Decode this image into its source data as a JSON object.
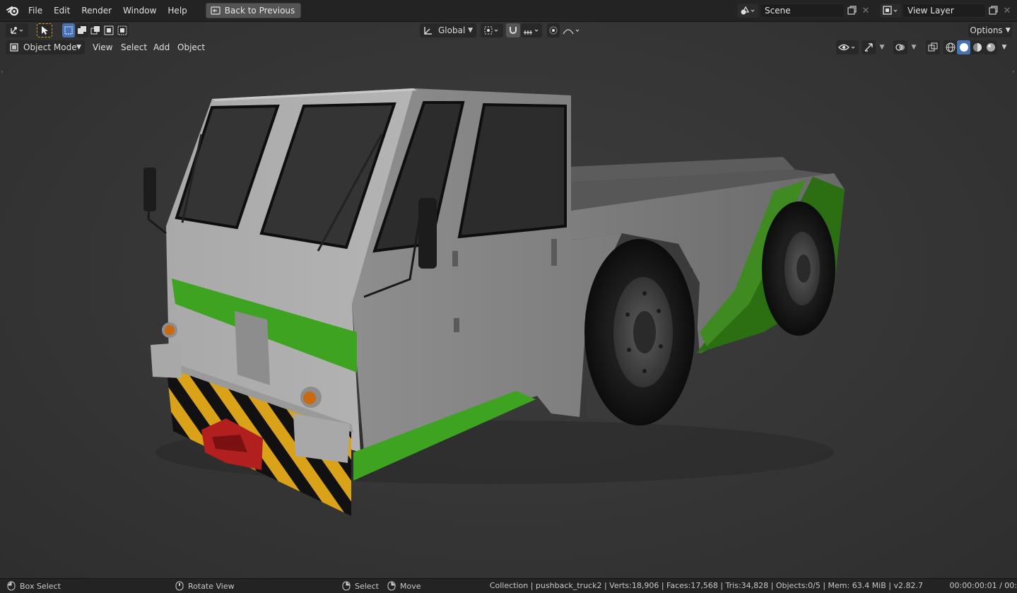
{
  "topbar": {
    "menus": [
      "File",
      "Edit",
      "Render",
      "Window",
      "Help"
    ],
    "back_button": "Back to Previous",
    "scene_name": "Scene",
    "view_layer_name": "View Layer"
  },
  "viewport_header": {
    "transform_orientation": "Global",
    "options_label": "Options",
    "mode": "Object Mode",
    "menus": [
      "View",
      "Select",
      "Add",
      "Object"
    ]
  },
  "statusbar": {
    "left_action": "Box Select",
    "middle_action": "Rotate View",
    "right_action_1": "Select",
    "right_action_2": "Move",
    "stats": "Collection | pushback_truck2 | Verts:18,906 | Faces:17,568 | Tris:34,828 | Objects:0/5 | Mem: 63.4 MiB | v2.82.7",
    "time": "00:00:00:01 / 00:"
  },
  "colors": {
    "accent": "#4772b3",
    "truck_green": "#3fa321",
    "hazard_yellow": "#d9a219",
    "tow_red": "#b21f1f"
  },
  "icons": {
    "app": "blender-logo-icon",
    "back": "back-to-previous-icon",
    "scene": "scene-icon",
    "view_layer": "view-layer-icon"
  }
}
